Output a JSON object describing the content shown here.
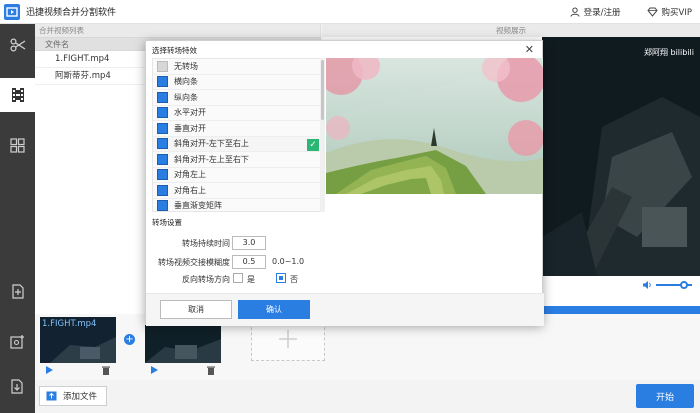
{
  "app": {
    "title": "迅捷视频合并分割软件"
  },
  "header": {
    "login_label": "登录/注册",
    "vip_label": "购买VIP"
  },
  "sidebar": {
    "items": [
      "scissors-icon",
      "film-strip-icon",
      "grid-icon",
      "import-icon",
      "settings-icon",
      "export-icon"
    ]
  },
  "left_panel": {
    "title": "合并视频列表",
    "column_header": "文件名",
    "files": [
      "1.FIGHT.mp4",
      "阿斯蒂芬.mp4"
    ]
  },
  "preview": {
    "title": "视频展示",
    "watermark": "郑阿翔 bilibili"
  },
  "timeline": {
    "clip1_name": "1.FIGHT.mp4"
  },
  "footer": {
    "add_file_label": "添加文件",
    "start_label": "开始"
  },
  "colors": {
    "accent": "#2a7de1",
    "sidebar_bg": "#3b3b3b",
    "check_green": "#2bb673"
  },
  "dialog": {
    "title": "选择转场特效",
    "effects": [
      "无转场",
      "横向条",
      "纵向条",
      "水平对开",
      "垂直对开",
      "斜角对开-左下至右上",
      "斜角对开-左上至右下",
      "对角左上",
      "对角右上",
      "垂直渐变矩阵"
    ],
    "selected_effect": "斜角对开-左下至右上",
    "settings_title": "转场设置",
    "duration_label": "转场持续时间",
    "duration_value": "3.0",
    "blur_label": "转场视频交接模糊度",
    "blur_value": "0.5",
    "blur_range": "0.0~1.0",
    "reverse_label": "反向转场方向",
    "yes_label": "是",
    "no_label": "否",
    "reverse_selected": "否",
    "cancel_label": "取消",
    "ok_label": "确认"
  }
}
